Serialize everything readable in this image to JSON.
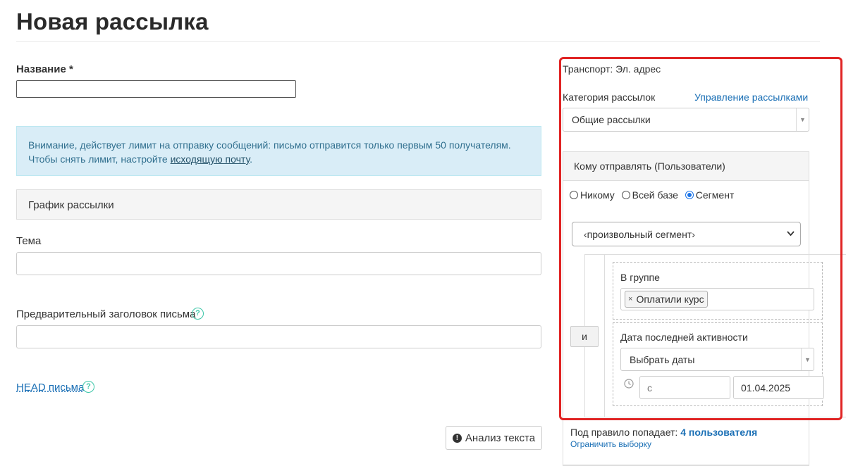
{
  "page": {
    "title": "Новая рассылка"
  },
  "form": {
    "name_label": "Название *",
    "name_value": "",
    "alert": {
      "text1": "Внимание, действует лимит на отправку сообщений: письмо отправится только первым 50 получателям.",
      "text2": "Чтобы снять лимит, настройте ",
      "link": "исходящую почту",
      "text3": "."
    },
    "schedule_label": "График рассылки",
    "subject_label": "Тема",
    "subject_value": "",
    "preheader_label": "Предварительный заголовок письма",
    "preheader_value": "",
    "head_link": "HEAD письма",
    "help_glyph": "?",
    "analyze_button": "Анализ текста",
    "analyze_icon": "exclamation-circle-icon"
  },
  "sidebar": {
    "transport": "Транспорт: Эл. адрес",
    "category_label": "Категория рассылок",
    "manage_link": "Управление рассылками",
    "category_value": "Общие рассылки",
    "recipients_header": "Кому отправлять (Пользователи)",
    "radio_options": [
      {
        "label": "Никому",
        "checked": false
      },
      {
        "label": "Всей базе",
        "checked": false
      },
      {
        "label": "Сегмент",
        "checked": true
      }
    ],
    "segment_select": "‹произвольный сегмент›",
    "and_button": "и",
    "conditions": {
      "group_label": "В группе",
      "group_tag": "Оплатили курс",
      "tag_remove": "×",
      "activity_label": "Дата последней активности",
      "date_select": "Выбрать даты",
      "from_placeholder": "с",
      "to_value": "01.04.2025"
    },
    "summary_prefix": "Под правило попадает: ",
    "summary_count": "4 пользователя",
    "limit_link": "Ограничить выборку"
  },
  "colors": {
    "accent_link": "#1a6fb5",
    "highlight_border": "#e02424",
    "alert_bg": "#d9edf7",
    "help_icon": "#3cc6a8"
  }
}
